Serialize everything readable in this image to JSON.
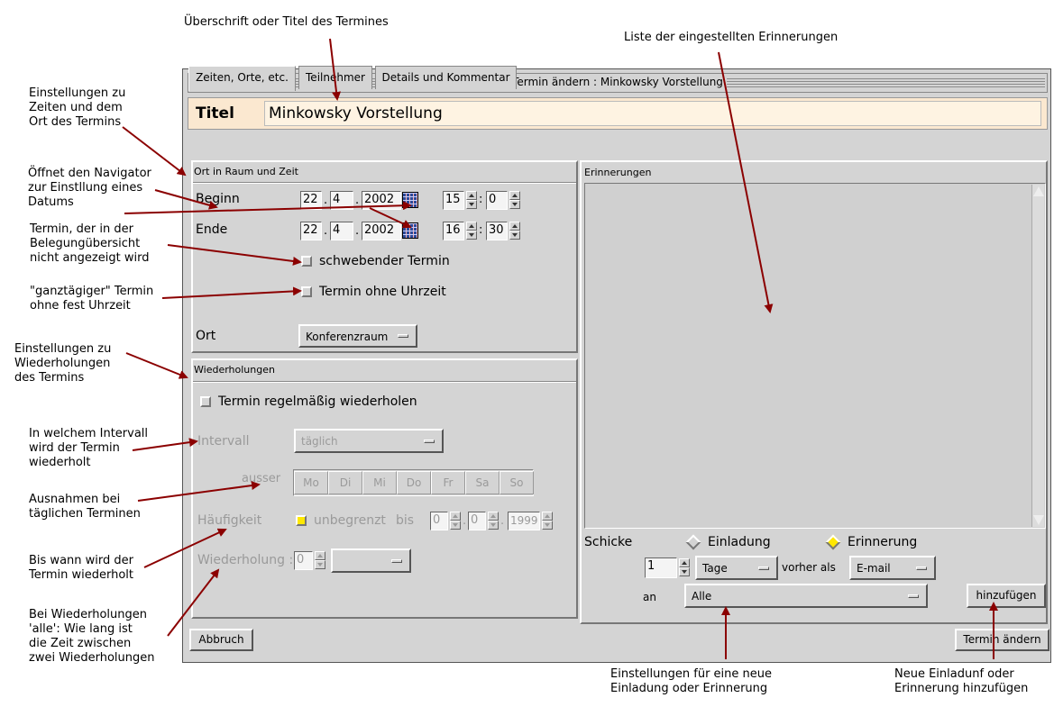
{
  "annotations": {
    "title_heading": "Überschrift oder Titel des Termines",
    "reminder_list": "Liste der eingestellten Erinnerungen",
    "times_places_1": "Einstellungen zu",
    "times_places_2": "Zeiten und dem",
    "times_places_3": "Ort des Termins",
    "navigator_1": "Öffnet den Navigator",
    "navigator_2": "zur Einstllung eines",
    "navigator_3": "Datums",
    "floating_1": "Termin, der in der",
    "floating_2": "Belegungübersicht",
    "floating_3": "nicht angezeigt wird",
    "allday_1": "\"ganztägiger\" Termin",
    "allday_2": "ohne fest Uhrzeit",
    "repeat_settings_1": "Einstellungen zu",
    "repeat_settings_2": "Wiederholungen",
    "repeat_settings_3": "des Termins",
    "interval_1": "In welchem Intervall",
    "interval_2": "wird der Termin",
    "interval_3": "wiederholt",
    "exceptions_1": "Ausnahmen bei",
    "exceptions_2": "täglichen Terminen",
    "until_1": "Bis wann wird der",
    "until_2": "Termin wiederholt",
    "gap_1": "Bei Wiederholungen",
    "gap_2": "'alle': Wie lang ist",
    "gap_3": "die Zeit zwischen",
    "gap_4": "zwei Wiederholungen",
    "new_invite_1": "Einstellungen für eine neue",
    "new_invite_2": "Einladung oder Erinnerung",
    "add_invite_1": "Neue Einladunf oder",
    "add_invite_2": "Erinnerung hinzufügen"
  },
  "window": {
    "title": "Termin ändern : Minkowsky Vorstellung",
    "title_label": "Titel",
    "title_value": "Minkowsky Vorstellung"
  },
  "tabs": [
    "Zeiten, Orte, etc.",
    "Teilnehmer",
    "Details und Kommentar"
  ],
  "time_place": {
    "header": "Ort in Raum und Zeit",
    "begin_label": "Beginn",
    "end_label": "Ende",
    "begin": {
      "day": "22",
      "month": "4",
      "year": "2002",
      "hour": "15",
      "minute": "0"
    },
    "end": {
      "day": "22",
      "month": "4",
      "year": "2002",
      "hour": "16",
      "minute": "30"
    },
    "date_sep": ".",
    "time_sep": ":",
    "floating_label": "schwebender Termin",
    "no_time_label": "Termin ohne Uhrzeit",
    "place_label": "Ort",
    "place_value": "Konferenzraum"
  },
  "repeat": {
    "header": "Wiederholungen",
    "enable_label": "Termin regelmäßig wiederholen",
    "interval_label": "Intervall",
    "interval_value": "täglich",
    "except_label": "ausser",
    "days": [
      "Mo",
      "Di",
      "Mi",
      "Do",
      "Fr",
      "Sa",
      "So"
    ],
    "frequency_label": "Häufigkeit",
    "unlimited_label": "unbegrenzt",
    "until_label": "bis",
    "until": {
      "day": "0",
      "month": "0",
      "year": "1999"
    },
    "repetition_label": "Wiederholung :",
    "repetition_value": "0"
  },
  "reminders": {
    "header": "Erinnerungen",
    "send_label": "Schicke",
    "opt_invite": "Einladung",
    "opt_reminder": "Erinnerung",
    "amount": "1",
    "unit": "Tage",
    "before_as": "vorher als",
    "medium": "E-mail",
    "to_label": "an",
    "recipients": "Alle",
    "add_button": "hinzufügen"
  },
  "footer": {
    "cancel": "Abbruch",
    "submit": "Termin ändern"
  },
  "colors": {
    "window_bg": "#d4d4d4",
    "title_bg": "#fbe8d0",
    "arrow": "#8b0000",
    "check_on": "#ffe800"
  }
}
